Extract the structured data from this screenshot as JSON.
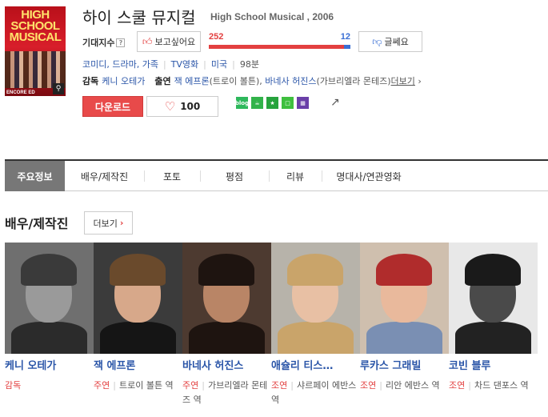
{
  "poster": {
    "title_text": "HIGH SCHOOL MUSICAL",
    "caption": "ENCORE ED",
    "zoom_icon": "magnifier-icon"
  },
  "movie": {
    "title": "하이 스쿨 뮤지컬",
    "subtitle": "High School Musical , 2006"
  },
  "rating": {
    "label": "기대지수",
    "help": "?",
    "want_label": "보고싶어요",
    "want_count": "252",
    "hate_count": "12",
    "want_ratio": 0.9545,
    "hate_label": "글쎄요"
  },
  "meta": {
    "genres": "코미디, 드라마, 가족",
    "format": "TV영화",
    "country": "미국",
    "runtime": "98분"
  },
  "credits": {
    "director_label": "감독",
    "director": "케니 오테가",
    "cast_label": "출연",
    "actor1": "잭 에프론",
    "actor1_role": "(트로이 볼튼)",
    "sep": ",",
    "actor2": "바네사 허진스",
    "actor2_role": "(가브리엘라 몬테즈)",
    "more": "더보기",
    "more_chevron": "›"
  },
  "actions": {
    "download": "다운로드",
    "like_count": "100"
  },
  "share": {
    "blog_label": "blog",
    "icons": [
      "naver-blog-icon",
      "cafe-icon",
      "bookmark-icon",
      "me2day-icon",
      "clip-icon"
    ],
    "share_icon": "share-icon"
  },
  "tabs": [
    "주요정보",
    "배우/제작진",
    "포토",
    "평점",
    "리뷰",
    "명대사/연관영화"
  ],
  "cast_section": {
    "title": "배우/제작진",
    "more": "더보기"
  },
  "cast": [
    {
      "name": "케니 오테가",
      "kind": "감독",
      "role": "",
      "skin": "#9a9a9a",
      "hair": "#3a3a3a",
      "bg": "#6f6f6f",
      "body": "#2b2b2b"
    },
    {
      "name": "잭 에프론",
      "kind": "주연",
      "role": "트로이 볼튼 역",
      "skin": "#d7a88a",
      "hair": "#6a4a2c",
      "bg": "#3b3b3b",
      "body": "#151515"
    },
    {
      "name": "바네사 허진스",
      "kind": "주연",
      "role": "가브리엘라 몬테즈 역",
      "skin": "#b98566",
      "hair": "#1e1410",
      "bg": "#4d3a30",
      "body": "#1e1410"
    },
    {
      "name": "애슐리 티스…",
      "kind": "조연",
      "role": "샤르페이 에반스 역",
      "skin": "#e8c0a4",
      "hair": "#c9a46a",
      "bg": "#b7b3aa",
      "body": "#c9a46a"
    },
    {
      "name": "루카스 그래빌",
      "kind": "조연",
      "role": "리안 에반스 역",
      "skin": "#e9b99c",
      "hair": "#b02c2c",
      "bg": "#cfbfae",
      "body": "#7a8fb3"
    },
    {
      "name": "코빈 블루",
      "kind": "조연",
      "role": "차드 댄포스 역",
      "skin": "#4a4a4a",
      "hair": "#1a1a1a",
      "bg": "#e8e8e8",
      "body": "#222222"
    }
  ]
}
